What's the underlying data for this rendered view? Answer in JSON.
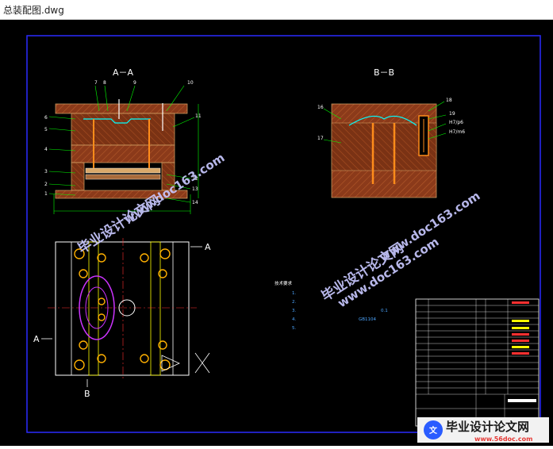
{
  "window": {
    "title": "总装配图.dwg"
  },
  "drawing": {
    "section_aa_label": "A－A",
    "section_bb_label": "B－B",
    "plan_cut_right": "A",
    "plan_cut_left": "A",
    "plan_cut_bottom": "B",
    "aa_callouts": [
      "7",
      "8",
      "9",
      "10",
      "6",
      "5",
      "4",
      "3",
      "2",
      "1",
      "11",
      "12",
      "13",
      "14"
    ],
    "bb_callouts": [
      "16",
      "17",
      "18",
      "19",
      "H7/p6",
      "H7/m6"
    ],
    "tech_requirements_title": "技术要求",
    "tech_requirements": [
      "1.",
      "2.",
      "3.",
      "4.",
      "5."
    ],
    "visible_tolerance": "0.1",
    "visible_standard": "GB1104"
  },
  "watermarks": {
    "upper_site": "www.doc163.com",
    "upper_cn": "毕业设计论文网",
    "middle_site": "www.doc163.com",
    "middle_cn": "毕业设计论文网",
    "right_site": "www.doc163.com",
    "bottom_cn": "毕业设计论文网",
    "bottom_site": "www.56doc.com"
  },
  "colors": {
    "canvas": "#000000",
    "frame": "#2a2aff",
    "cad_section": "#8b3a1a",
    "cad_outline": "#00ff00",
    "cad_text": "#ffffff",
    "watermark": "#c8c8ff"
  }
}
